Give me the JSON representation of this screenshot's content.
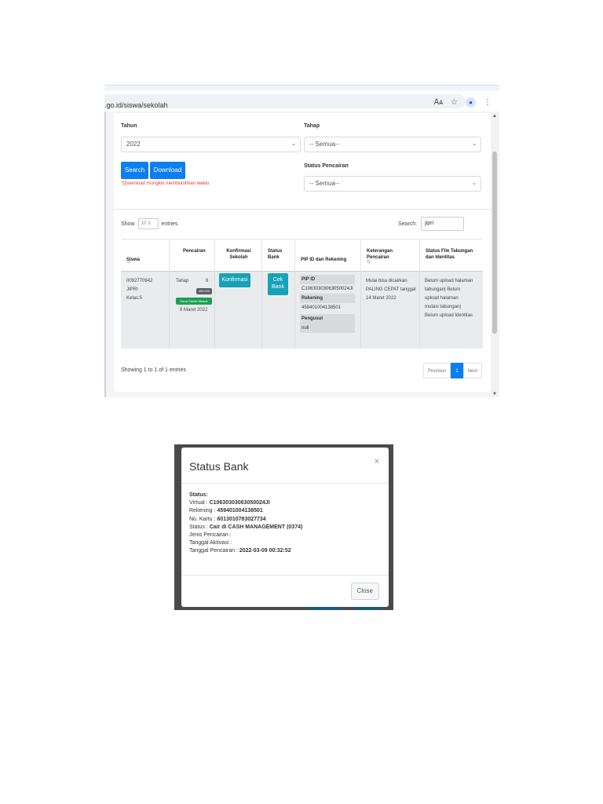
{
  "browser": {
    "address": ".go.id/siswa/sekolah",
    "icons": [
      "translate-icon",
      "star-icon",
      "profile-icon",
      "menu-icon"
    ]
  },
  "filters": {
    "tahun_label": "Tahun",
    "tahun_value": "2022",
    "tahap_label": "Tahap",
    "tahap_value": "-- Semua--",
    "status_pencairan_label": "Status Pencairan",
    "status_pencairan_value": "-- Semua--",
    "search_button": "Search",
    "download_button": "Download",
    "download_note": "*)Download mungkin membutuhkan waktu"
  },
  "table_controls": {
    "show_label": "Show",
    "show_value": "10",
    "entries_label": "entries",
    "search_label": "Search:",
    "search_value": "jipri"
  },
  "table": {
    "headers": [
      "Siswa",
      "Pencairan",
      "Konfirmasi Sekolah",
      "Status Bank",
      "PIP ID dan Rekening",
      "Keterangan Pencairan",
      "Status File Tabungan dan Identitas"
    ],
    "row": {
      "siswa_id": "0092770942",
      "siswa_name": "JIPRI",
      "siswa_kelas": "Kelas:5",
      "tahap_label": "Tahap",
      "tahap_value": "6",
      "amount": "450.000",
      "dana_badge": "Dana Sudah Masuk",
      "pencairan_date": "8 Maret 2022",
      "konfirmasi_button": "Konfirmasi",
      "cek_bank_line1": "Cek",
      "cek_bank_line2": "Bank",
      "pip_id_label": "PIP ID",
      "pip_id_value": "C10630303063050024JI",
      "rekening_label": "Rekening",
      "rekening_value": "459401004138501",
      "pengusul_label": "Pengusul",
      "pengusul_value": "null",
      "keterangan_line1": "Mulai bisa dicairkan",
      "keterangan_line2": "PALING CEPAT tanggal",
      "keterangan_line3": "14 Maret 2022",
      "status_file_line1": "Belum upload halaman",
      "status_file_line2": "tabungan| Belum",
      "status_file_line3": "upload halaman",
      "status_file_line4": "mutasi tabungan|",
      "status_file_line5": "Belum upload Identitas"
    }
  },
  "footer": {
    "showing": "Showing 1 to 1 of 1 entries",
    "previous": "Previous",
    "page": "1",
    "next": "Next"
  },
  "modal": {
    "title": "Status Bank",
    "close_x": "×",
    "status_heading": "Status:",
    "virtual_label": "Virtual : ",
    "virtual_value": "C10630303063050024JI",
    "rekening_label": "Rekening : ",
    "rekening_value": "459401004138501",
    "kartu_label": "No. Kartu : ",
    "kartu_value": "6013010783027734",
    "status_label": "Status : ",
    "status_value": "Cair di CASH MANAGEMENT (0374)",
    "jenis_label": "Jenis Pencairan :",
    "aktivasi_label": "Tanggal Aktivasi :",
    "tanggal_label": "Tanggal Pencairan : ",
    "tanggal_value": "2022-03-09 00:32:52",
    "close_button": "Close"
  }
}
